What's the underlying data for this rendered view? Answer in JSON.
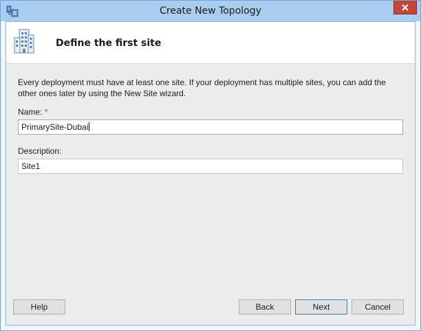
{
  "window": {
    "title": "Create New Topology",
    "close_symbol": "✕"
  },
  "header": {
    "title": "Define the first site"
  },
  "body": {
    "description_line1": "Every deployment must have at least one site. If your deployment has multiple sites, you can add the",
    "description_line2": "other ones later by using the New Site wizard.",
    "name_label": "Name:",
    "required_mark": "*",
    "name_value": "PrimarySite-Dubai",
    "description_label": "Description:",
    "description_value": "Site1"
  },
  "buttons": {
    "help": "Help",
    "back": "Back",
    "next": "Next",
    "cancel": "Cancel"
  },
  "icons": {
    "app": "topology-app-icon",
    "header": "building-icon",
    "close": "close-icon"
  },
  "colors": {
    "titlebar": "#a9cdef",
    "close_button": "#c4463a",
    "required": "#c4463a",
    "dialog_background": "#ececec"
  }
}
